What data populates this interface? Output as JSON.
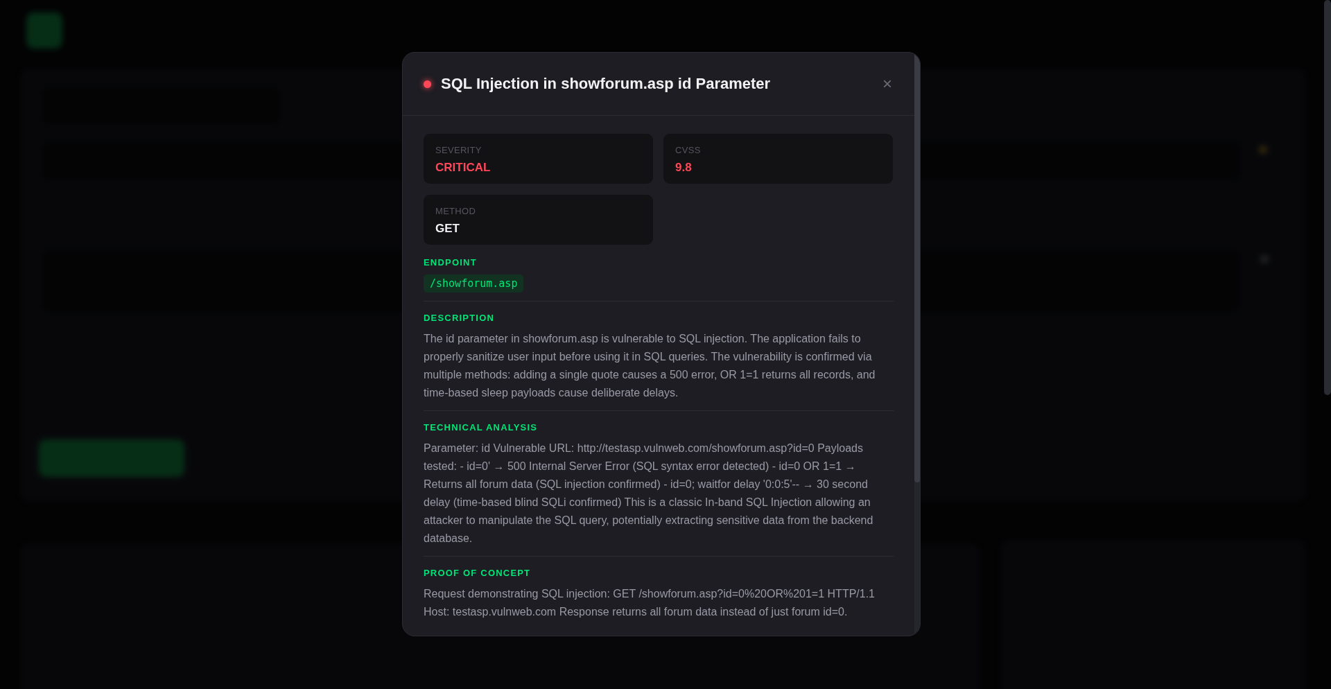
{
  "dialog": {
    "title": "SQL Injection in showforum.asp id Parameter",
    "close": "×",
    "fields": [
      {
        "label": "SEVERITY",
        "value": "CRITICAL",
        "kind": "danger"
      },
      {
        "label": "CVSS",
        "value": "9.8",
        "kind": "danger"
      },
      {
        "label": "METHOD",
        "value": "GET",
        "kind": "plain"
      }
    ],
    "sections": [
      {
        "heading": "ENDPOINT",
        "kind": "code",
        "text": "/showforum.asp"
      },
      {
        "heading": "DESCRIPTION",
        "kind": "paragraph",
        "text": "The id parameter in showforum.asp is vulnerable to SQL injection. The application fails to properly sanitize user input before using it in SQL queries. The vulnerability is confirmed via multiple methods: adding a single quote causes a 500 error, OR 1=1 returns all records, and time-based sleep payloads cause deliberate delays."
      },
      {
        "heading": "TECHNICAL ANALYSIS",
        "kind": "paragraph",
        "text": "Parameter: id Vulnerable URL: http://testasp.vulnweb.com/showforum.asp?id=0 Payloads tested: - id=0' → 500 Internal Server Error (SQL syntax error detected) - id=0 OR 1=1 → Returns all forum data (SQL injection confirmed) - id=0; waitfor delay '0:0:5'-- → 30 second delay (time-based blind SQLi confirmed) This is a classic In-band SQL Injection allowing an attacker to manipulate the SQL query, potentially extracting sensitive data from the backend database."
      },
      {
        "heading": "PROOF OF CONCEPT",
        "kind": "paragraph",
        "text": "Request demonstrating SQL injection: GET /showforum.asp?id=0%20OR%201=1 HTTP/1.1 Host: testasp.vulnweb.com Response returns all forum data instead of just forum id=0."
      }
    ]
  }
}
